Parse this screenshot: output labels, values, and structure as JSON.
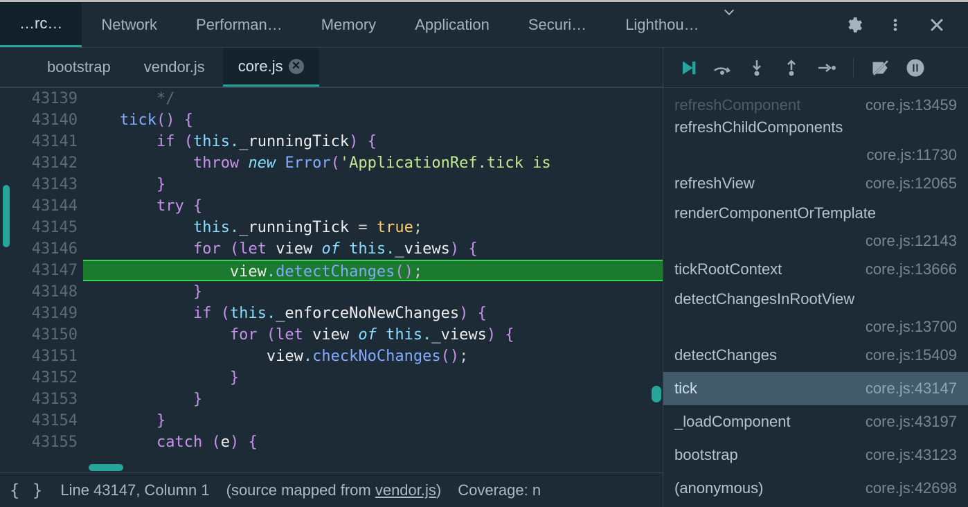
{
  "mainTabs": {
    "activeTruncated": "…rc…",
    "items": [
      "Network",
      "Performan…",
      "Memory",
      "Application",
      "Securi…",
      "Lighthou…"
    ]
  },
  "fileTabs": {
    "items": [
      "bootstrap",
      "vendor.js",
      "core.js"
    ],
    "activeIndex": 2
  },
  "editor": {
    "startLine": 43139,
    "currentIndex": 8,
    "lines": [
      {
        "t": "cmt",
        "txt": "        */"
      },
      {
        "t": "code",
        "txt": "    tick() {"
      },
      {
        "t": "code",
        "txt": "        if (this._runningTick) {"
      },
      {
        "t": "code",
        "txt": "            throw new Error('ApplicationRef.tick is "
      },
      {
        "t": "code",
        "txt": "        }"
      },
      {
        "t": "code",
        "txt": "        try {"
      },
      {
        "t": "code",
        "txt": "            this._runningTick = true;"
      },
      {
        "t": "code",
        "txt": "            for (let view of this._views) {"
      },
      {
        "t": "code",
        "txt": "                view.detectChanges();"
      },
      {
        "t": "code",
        "txt": "            }"
      },
      {
        "t": "code",
        "txt": "            if (this._enforceNoNewChanges) {"
      },
      {
        "t": "code",
        "txt": "                for (let view of this._views) {"
      },
      {
        "t": "code",
        "txt": "                    view.checkNoChanges();"
      },
      {
        "t": "code",
        "txt": "                }"
      },
      {
        "t": "code",
        "txt": "            }"
      },
      {
        "t": "code",
        "txt": "        }"
      },
      {
        "t": "code",
        "txt": "        catch (e) {"
      }
    ]
  },
  "statusBar": {
    "braces": "{ }",
    "pos": "Line 43147, Column 1",
    "mappedPrefix": "(source mapped from ",
    "mappedFile": "vendor.js",
    "mappedSuffix": ")",
    "coverage": "Coverage: n"
  },
  "callStack": {
    "fadedTop": {
      "name": "refreshComponent",
      "loc": "core.js:13459"
    },
    "rows": [
      {
        "name": "refreshChildComponents",
        "loc": "core.js:11730",
        "twoLine": true
      },
      {
        "name": "refreshView",
        "loc": "core.js:12065"
      },
      {
        "name": "renderComponentOrTemplate",
        "loc": "core.js:12143",
        "twoLine": true
      },
      {
        "name": "tickRootContext",
        "loc": "core.js:13666"
      },
      {
        "name": "detectChangesInRootView",
        "loc": "core.js:13700",
        "twoLine": true
      },
      {
        "name": "detectChanges",
        "loc": "core.js:15409"
      },
      {
        "name": "tick",
        "loc": "core.js:43147",
        "selected": true
      },
      {
        "name": "_loadComponent",
        "loc": "core.js:43197"
      },
      {
        "name": "bootstrap",
        "loc": "core.js:43123"
      },
      {
        "name": "(anonymous)",
        "loc": "core.js:42698"
      }
    ]
  }
}
